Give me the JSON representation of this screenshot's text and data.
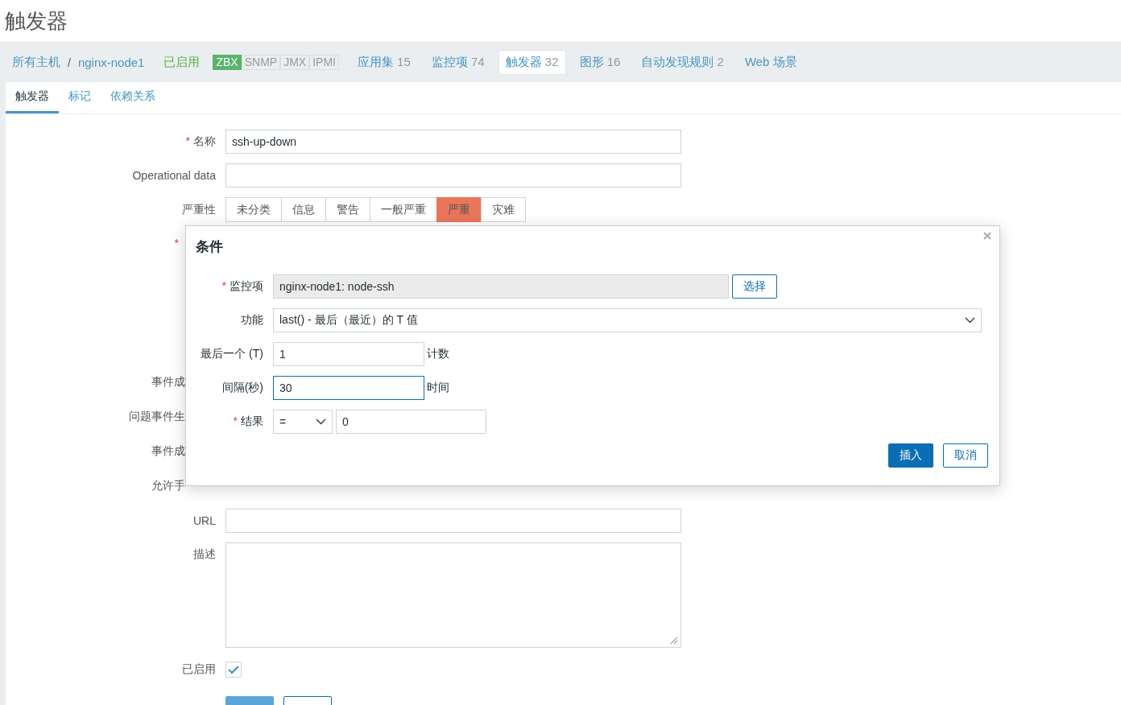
{
  "page_title": "触发器",
  "breadcrumbs": [
    {
      "label": "所有主机"
    },
    {
      "label": "nginx-node1"
    }
  ],
  "breadcrumb_separator": "/",
  "host_status": "已启用",
  "availability": [
    {
      "label": "ZBX",
      "available": true
    },
    {
      "label": "SNMP",
      "available": false
    },
    {
      "label": "JMX",
      "available": false
    },
    {
      "label": "IPMI",
      "available": false
    }
  ],
  "host_nav": [
    {
      "label": "应用集",
      "count": "15",
      "selected": false
    },
    {
      "label": "监控项",
      "count": "74",
      "selected": false
    },
    {
      "label": "触发器",
      "count": "32",
      "selected": true
    },
    {
      "label": "图形",
      "count": "16",
      "selected": false
    },
    {
      "label": "自动发现规则",
      "count": "2",
      "selected": false
    },
    {
      "label": "Web 场景",
      "selected": false
    }
  ],
  "tabs": [
    {
      "label": "触发器",
      "selected": true
    },
    {
      "label": "标记",
      "selected": false
    },
    {
      "label": "依赖关系",
      "selected": false
    }
  ],
  "form": {
    "name": {
      "required_mark": "*",
      "label": "名称",
      "value": "ssh-up-down"
    },
    "operational_data": {
      "label": "Operational data"
    },
    "severity": {
      "label": "严重性",
      "options": [
        {
          "label": "未分类",
          "selected": false
        },
        {
          "label": "信息",
          "selected": false
        },
        {
          "label": "警告",
          "selected": false
        },
        {
          "label": "一般严重",
          "selected": false
        },
        {
          "label": "严重",
          "selected": true
        },
        {
          "label": "灾难",
          "selected": false
        }
      ]
    },
    "expression": {
      "required_mark": "*"
    },
    "covered_rows": [
      {
        "label": "事件成"
      },
      {
        "label": "问题事件生"
      },
      {
        "label": "事件成"
      },
      {
        "label": "允许手"
      }
    ],
    "url": {
      "label": "URL"
    },
    "description": {
      "label": "描述"
    },
    "enabled": {
      "label": "已启用",
      "checked": true
    },
    "buttons": [
      {
        "kind": "primary"
      },
      {
        "kind": "secondary"
      }
    ]
  },
  "dialog": {
    "title": "条件",
    "item": {
      "required_mark": "*",
      "label": "监控项",
      "value": "nginx-node1: node-ssh",
      "button": "选择"
    },
    "function": {
      "label": "功能",
      "value": "last() - 最后（最近）的 T 值"
    },
    "last_t": {
      "label": "最后一个 (T)",
      "value": "1",
      "unit": "计数",
      "focused": false
    },
    "interval": {
      "label": "间隔(秒)",
      "value": "30",
      "unit": "时间",
      "focused": true
    },
    "result": {
      "required_mark": "*",
      "label": "结果",
      "operator": "=",
      "value": "0"
    },
    "buttons": [
      {
        "label": "插入",
        "kind": "primary"
      },
      {
        "label": "取消",
        "kind": "secondary"
      }
    ]
  }
}
